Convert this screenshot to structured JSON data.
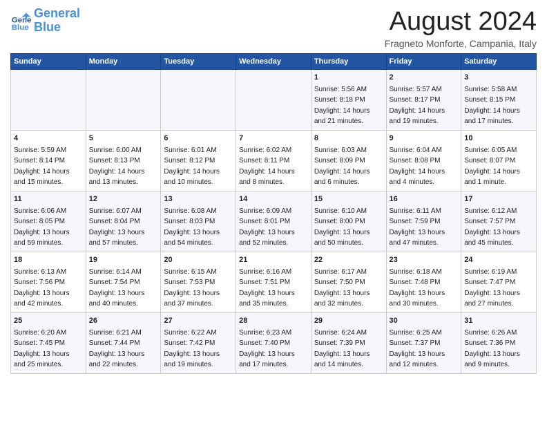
{
  "header": {
    "logo_line1": "General",
    "logo_line2": "Blue",
    "month_year": "August 2024",
    "location": "Fragneto Monforte, Campania, Italy"
  },
  "weekdays": [
    "Sunday",
    "Monday",
    "Tuesday",
    "Wednesday",
    "Thursday",
    "Friday",
    "Saturday"
  ],
  "weeks": [
    [
      {
        "day": "",
        "info": ""
      },
      {
        "day": "",
        "info": ""
      },
      {
        "day": "",
        "info": ""
      },
      {
        "day": "",
        "info": ""
      },
      {
        "day": "1",
        "info": "Sunrise: 5:56 AM\nSunset: 8:18 PM\nDaylight: 14 hours\nand 21 minutes."
      },
      {
        "day": "2",
        "info": "Sunrise: 5:57 AM\nSunset: 8:17 PM\nDaylight: 14 hours\nand 19 minutes."
      },
      {
        "day": "3",
        "info": "Sunrise: 5:58 AM\nSunset: 8:15 PM\nDaylight: 14 hours\nand 17 minutes."
      }
    ],
    [
      {
        "day": "4",
        "info": "Sunrise: 5:59 AM\nSunset: 8:14 PM\nDaylight: 14 hours\nand 15 minutes."
      },
      {
        "day": "5",
        "info": "Sunrise: 6:00 AM\nSunset: 8:13 PM\nDaylight: 14 hours\nand 13 minutes."
      },
      {
        "day": "6",
        "info": "Sunrise: 6:01 AM\nSunset: 8:12 PM\nDaylight: 14 hours\nand 10 minutes."
      },
      {
        "day": "7",
        "info": "Sunrise: 6:02 AM\nSunset: 8:11 PM\nDaylight: 14 hours\nand 8 minutes."
      },
      {
        "day": "8",
        "info": "Sunrise: 6:03 AM\nSunset: 8:09 PM\nDaylight: 14 hours\nand 6 minutes."
      },
      {
        "day": "9",
        "info": "Sunrise: 6:04 AM\nSunset: 8:08 PM\nDaylight: 14 hours\nand 4 minutes."
      },
      {
        "day": "10",
        "info": "Sunrise: 6:05 AM\nSunset: 8:07 PM\nDaylight: 14 hours\nand 1 minute."
      }
    ],
    [
      {
        "day": "11",
        "info": "Sunrise: 6:06 AM\nSunset: 8:05 PM\nDaylight: 13 hours\nand 59 minutes."
      },
      {
        "day": "12",
        "info": "Sunrise: 6:07 AM\nSunset: 8:04 PM\nDaylight: 13 hours\nand 57 minutes."
      },
      {
        "day": "13",
        "info": "Sunrise: 6:08 AM\nSunset: 8:03 PM\nDaylight: 13 hours\nand 54 minutes."
      },
      {
        "day": "14",
        "info": "Sunrise: 6:09 AM\nSunset: 8:01 PM\nDaylight: 13 hours\nand 52 minutes."
      },
      {
        "day": "15",
        "info": "Sunrise: 6:10 AM\nSunset: 8:00 PM\nDaylight: 13 hours\nand 50 minutes."
      },
      {
        "day": "16",
        "info": "Sunrise: 6:11 AM\nSunset: 7:59 PM\nDaylight: 13 hours\nand 47 minutes."
      },
      {
        "day": "17",
        "info": "Sunrise: 6:12 AM\nSunset: 7:57 PM\nDaylight: 13 hours\nand 45 minutes."
      }
    ],
    [
      {
        "day": "18",
        "info": "Sunrise: 6:13 AM\nSunset: 7:56 PM\nDaylight: 13 hours\nand 42 minutes."
      },
      {
        "day": "19",
        "info": "Sunrise: 6:14 AM\nSunset: 7:54 PM\nDaylight: 13 hours\nand 40 minutes."
      },
      {
        "day": "20",
        "info": "Sunrise: 6:15 AM\nSunset: 7:53 PM\nDaylight: 13 hours\nand 37 minutes."
      },
      {
        "day": "21",
        "info": "Sunrise: 6:16 AM\nSunset: 7:51 PM\nDaylight: 13 hours\nand 35 minutes."
      },
      {
        "day": "22",
        "info": "Sunrise: 6:17 AM\nSunset: 7:50 PM\nDaylight: 13 hours\nand 32 minutes."
      },
      {
        "day": "23",
        "info": "Sunrise: 6:18 AM\nSunset: 7:48 PM\nDaylight: 13 hours\nand 30 minutes."
      },
      {
        "day": "24",
        "info": "Sunrise: 6:19 AM\nSunset: 7:47 PM\nDaylight: 13 hours\nand 27 minutes."
      }
    ],
    [
      {
        "day": "25",
        "info": "Sunrise: 6:20 AM\nSunset: 7:45 PM\nDaylight: 13 hours\nand 25 minutes."
      },
      {
        "day": "26",
        "info": "Sunrise: 6:21 AM\nSunset: 7:44 PM\nDaylight: 13 hours\nand 22 minutes."
      },
      {
        "day": "27",
        "info": "Sunrise: 6:22 AM\nSunset: 7:42 PM\nDaylight: 13 hours\nand 19 minutes."
      },
      {
        "day": "28",
        "info": "Sunrise: 6:23 AM\nSunset: 7:40 PM\nDaylight: 13 hours\nand 17 minutes."
      },
      {
        "day": "29",
        "info": "Sunrise: 6:24 AM\nSunset: 7:39 PM\nDaylight: 13 hours\nand 14 minutes."
      },
      {
        "day": "30",
        "info": "Sunrise: 6:25 AM\nSunset: 7:37 PM\nDaylight: 13 hours\nand 12 minutes."
      },
      {
        "day": "31",
        "info": "Sunrise: 6:26 AM\nSunset: 7:36 PM\nDaylight: 13 hours\nand 9 minutes."
      }
    ]
  ]
}
